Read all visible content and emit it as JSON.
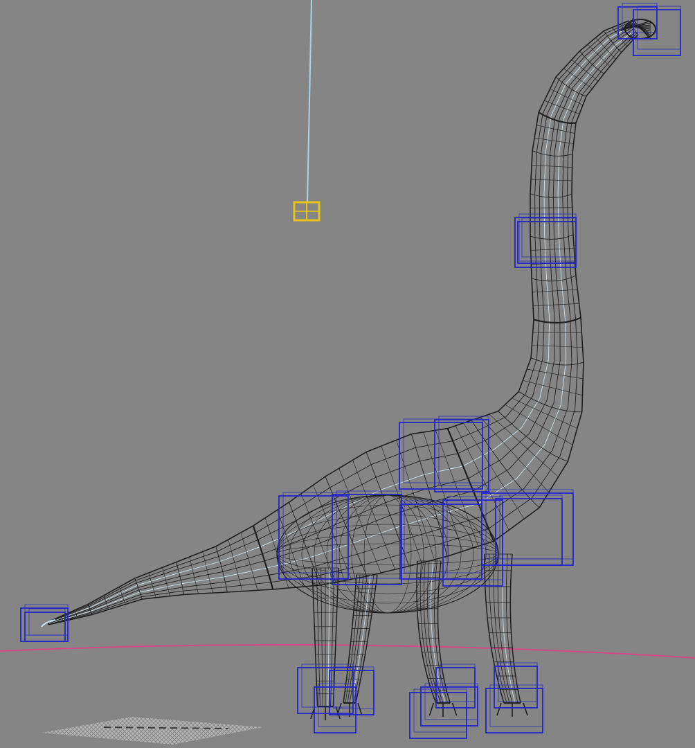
{
  "viewport": {
    "background": "#858585",
    "wire_color": "#1e1e1e",
    "highlight_wire_color": "#cfe4ee",
    "control_color": "#2424c8",
    "selected_control_color": "#e8c21a",
    "light_line_color": "#a9d4ea",
    "ground_color": "#d24a84"
  },
  "scene": {
    "model": "dinosaur-wireframe",
    "icons": [
      "light-icon",
      "bone-control-box",
      "ground-grid-icon"
    ]
  }
}
